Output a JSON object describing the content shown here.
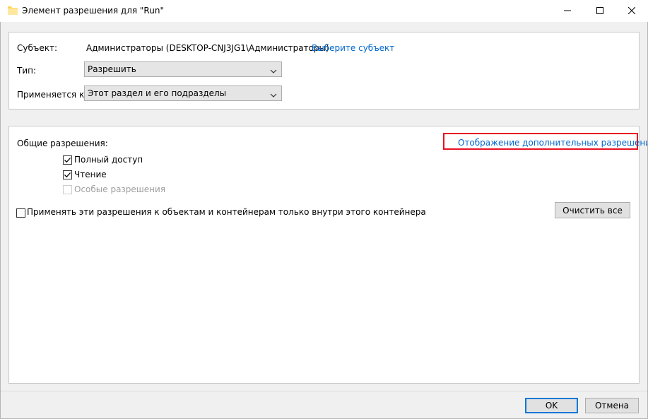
{
  "window": {
    "title": "Элемент разрешения для \"Run\""
  },
  "top": {
    "subject_label": "Субъект:",
    "subject_value": "Администраторы (DESKTOP-CNJ3JG1\\Администраторы)",
    "select_subject_link": "Выберите субъект",
    "type_label": "Тип:",
    "type_value": "Разрешить",
    "applies_label": "Применяется к:",
    "applies_value": "Этот раздел и его подразделы"
  },
  "permissions": {
    "header": "Общие разрешения:",
    "advanced_link": "Отображение дополнительных разрешений",
    "items": [
      {
        "label": "Полный доступ",
        "checked": true,
        "disabled": false
      },
      {
        "label": "Чтение",
        "checked": true,
        "disabled": false
      },
      {
        "label": "Особые разрешения",
        "checked": false,
        "disabled": true
      }
    ],
    "apply_only_label": "Применять эти разрешения к объектам и контейнерам только внутри этого контейнера",
    "apply_only_checked": false,
    "clear_all_label": "Очистить все"
  },
  "footer": {
    "ok_label": "OK",
    "cancel_label": "Отмена"
  },
  "colors": {
    "link": "#0066cc",
    "highlight": "#e81123",
    "default_button_border": "#0078d7"
  }
}
